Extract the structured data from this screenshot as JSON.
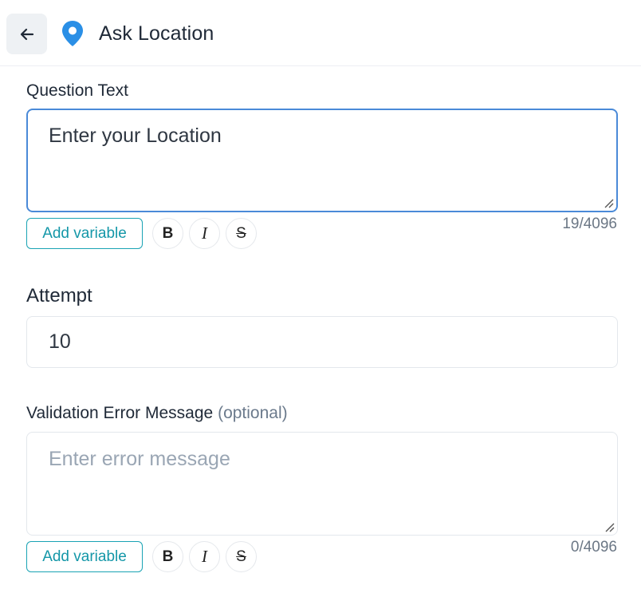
{
  "header": {
    "title": "Ask Location",
    "back_icon": "arrow-left-icon",
    "node_icon": "location-pin-icon",
    "accent_color": "#2a8fe6"
  },
  "question": {
    "label": "Question Text",
    "value": "Enter your Location",
    "counter": "19/4096",
    "add_variable_label": "Add variable",
    "format_buttons": {
      "bold": "B",
      "italic": "I",
      "strike": "S"
    }
  },
  "attempt": {
    "label": "Attempt",
    "value": "10"
  },
  "validation": {
    "label": "Validation Error Message",
    "optional": "(optional)",
    "placeholder": "Enter error message",
    "counter": "0/4096",
    "add_variable_label": "Add variable",
    "format_buttons": {
      "bold": "B",
      "italic": "I",
      "strike": "S"
    }
  }
}
